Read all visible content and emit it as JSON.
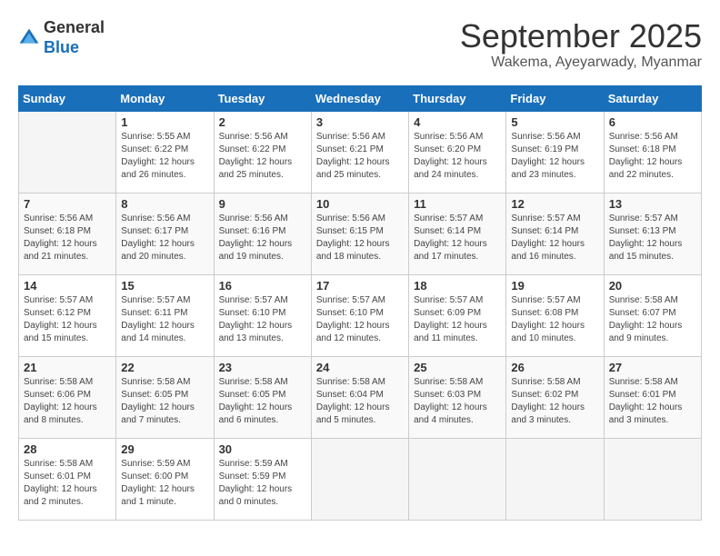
{
  "header": {
    "logo_general": "General",
    "logo_blue": "Blue",
    "month_title": "September 2025",
    "location": "Wakema, Ayeyarwady, Myanmar"
  },
  "days_of_week": [
    "Sunday",
    "Monday",
    "Tuesday",
    "Wednesday",
    "Thursday",
    "Friday",
    "Saturday"
  ],
  "weeks": [
    [
      {
        "num": "",
        "info": ""
      },
      {
        "num": "1",
        "info": "Sunrise: 5:55 AM\nSunset: 6:22 PM\nDaylight: 12 hours\nand 26 minutes."
      },
      {
        "num": "2",
        "info": "Sunrise: 5:56 AM\nSunset: 6:22 PM\nDaylight: 12 hours\nand 25 minutes."
      },
      {
        "num": "3",
        "info": "Sunrise: 5:56 AM\nSunset: 6:21 PM\nDaylight: 12 hours\nand 25 minutes."
      },
      {
        "num": "4",
        "info": "Sunrise: 5:56 AM\nSunset: 6:20 PM\nDaylight: 12 hours\nand 24 minutes."
      },
      {
        "num": "5",
        "info": "Sunrise: 5:56 AM\nSunset: 6:19 PM\nDaylight: 12 hours\nand 23 minutes."
      },
      {
        "num": "6",
        "info": "Sunrise: 5:56 AM\nSunset: 6:18 PM\nDaylight: 12 hours\nand 22 minutes."
      }
    ],
    [
      {
        "num": "7",
        "info": "Sunrise: 5:56 AM\nSunset: 6:18 PM\nDaylight: 12 hours\nand 21 minutes."
      },
      {
        "num": "8",
        "info": "Sunrise: 5:56 AM\nSunset: 6:17 PM\nDaylight: 12 hours\nand 20 minutes."
      },
      {
        "num": "9",
        "info": "Sunrise: 5:56 AM\nSunset: 6:16 PM\nDaylight: 12 hours\nand 19 minutes."
      },
      {
        "num": "10",
        "info": "Sunrise: 5:56 AM\nSunset: 6:15 PM\nDaylight: 12 hours\nand 18 minutes."
      },
      {
        "num": "11",
        "info": "Sunrise: 5:57 AM\nSunset: 6:14 PM\nDaylight: 12 hours\nand 17 minutes."
      },
      {
        "num": "12",
        "info": "Sunrise: 5:57 AM\nSunset: 6:14 PM\nDaylight: 12 hours\nand 16 minutes."
      },
      {
        "num": "13",
        "info": "Sunrise: 5:57 AM\nSunset: 6:13 PM\nDaylight: 12 hours\nand 15 minutes."
      }
    ],
    [
      {
        "num": "14",
        "info": "Sunrise: 5:57 AM\nSunset: 6:12 PM\nDaylight: 12 hours\nand 15 minutes."
      },
      {
        "num": "15",
        "info": "Sunrise: 5:57 AM\nSunset: 6:11 PM\nDaylight: 12 hours\nand 14 minutes."
      },
      {
        "num": "16",
        "info": "Sunrise: 5:57 AM\nSunset: 6:10 PM\nDaylight: 12 hours\nand 13 minutes."
      },
      {
        "num": "17",
        "info": "Sunrise: 5:57 AM\nSunset: 6:10 PM\nDaylight: 12 hours\nand 12 minutes."
      },
      {
        "num": "18",
        "info": "Sunrise: 5:57 AM\nSunset: 6:09 PM\nDaylight: 12 hours\nand 11 minutes."
      },
      {
        "num": "19",
        "info": "Sunrise: 5:57 AM\nSunset: 6:08 PM\nDaylight: 12 hours\nand 10 minutes."
      },
      {
        "num": "20",
        "info": "Sunrise: 5:58 AM\nSunset: 6:07 PM\nDaylight: 12 hours\nand 9 minutes."
      }
    ],
    [
      {
        "num": "21",
        "info": "Sunrise: 5:58 AM\nSunset: 6:06 PM\nDaylight: 12 hours\nand 8 minutes."
      },
      {
        "num": "22",
        "info": "Sunrise: 5:58 AM\nSunset: 6:05 PM\nDaylight: 12 hours\nand 7 minutes."
      },
      {
        "num": "23",
        "info": "Sunrise: 5:58 AM\nSunset: 6:05 PM\nDaylight: 12 hours\nand 6 minutes."
      },
      {
        "num": "24",
        "info": "Sunrise: 5:58 AM\nSunset: 6:04 PM\nDaylight: 12 hours\nand 5 minutes."
      },
      {
        "num": "25",
        "info": "Sunrise: 5:58 AM\nSunset: 6:03 PM\nDaylight: 12 hours\nand 4 minutes."
      },
      {
        "num": "26",
        "info": "Sunrise: 5:58 AM\nSunset: 6:02 PM\nDaylight: 12 hours\nand 3 minutes."
      },
      {
        "num": "27",
        "info": "Sunrise: 5:58 AM\nSunset: 6:01 PM\nDaylight: 12 hours\nand 3 minutes."
      }
    ],
    [
      {
        "num": "28",
        "info": "Sunrise: 5:58 AM\nSunset: 6:01 PM\nDaylight: 12 hours\nand 2 minutes."
      },
      {
        "num": "29",
        "info": "Sunrise: 5:59 AM\nSunset: 6:00 PM\nDaylight: 12 hours\nand 1 minute."
      },
      {
        "num": "30",
        "info": "Sunrise: 5:59 AM\nSunset: 5:59 PM\nDaylight: 12 hours\nand 0 minutes."
      },
      {
        "num": "",
        "info": ""
      },
      {
        "num": "",
        "info": ""
      },
      {
        "num": "",
        "info": ""
      },
      {
        "num": "",
        "info": ""
      }
    ]
  ]
}
